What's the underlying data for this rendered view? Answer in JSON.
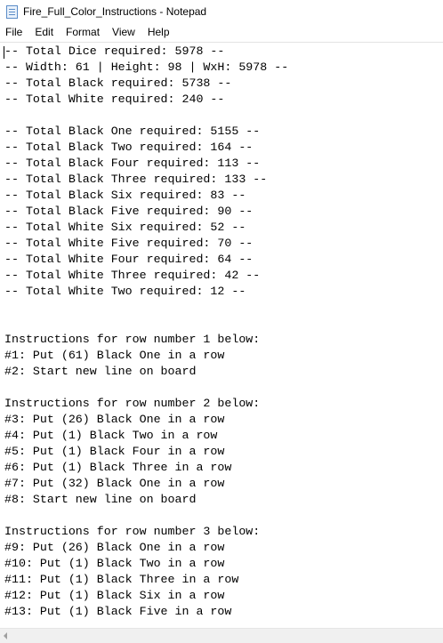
{
  "window": {
    "title": "Fire_Full_Color_Instructions - Notepad",
    "icon": "notepad-icon"
  },
  "menu": {
    "items": [
      "File",
      "Edit",
      "Format",
      "View",
      "Help"
    ]
  },
  "editor": {
    "text": "-- Total Dice required: 5978 --\n-- Width: 61 | Height: 98 | WxH: 5978 --\n-- Total Black required: 5738 --\n-- Total White required: 240 --\n\n-- Total Black One required: 5155 --\n-- Total Black Two required: 164 --\n-- Total Black Four required: 113 --\n-- Total Black Three required: 133 --\n-- Total Black Six required: 83 --\n-- Total Black Five required: 90 --\n-- Total White Six required: 52 --\n-- Total White Five required: 70 --\n-- Total White Four required: 64 --\n-- Total White Three required: 42 --\n-- Total White Two required: 12 --\n\n\nInstructions for row number 1 below:\n#1: Put (61) Black One in a row\n#2: Start new line on board\n\nInstructions for row number 2 below:\n#3: Put (26) Black One in a row\n#4: Put (1) Black Two in a row\n#5: Put (1) Black Four in a row\n#6: Put (1) Black Three in a row\n#7: Put (32) Black One in a row\n#8: Start new line on board\n\nInstructions for row number 3 below:\n#9: Put (26) Black One in a row\n#10: Put (1) Black Two in a row\n#11: Put (1) Black Three in a row\n#12: Put (1) Black Six in a row\n#13: Put (1) Black Five in a row"
  },
  "scrollbar": {
    "left_arrow_icon": "scroll-left-arrow-icon"
  }
}
